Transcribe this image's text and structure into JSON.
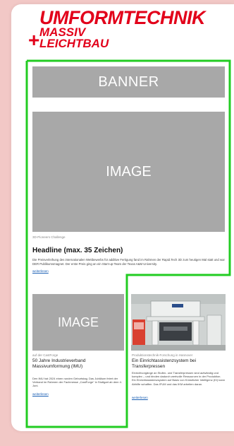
{
  "logo": {
    "line1": "UMFORMTECHNIK",
    "plus": "+",
    "line2a": "MASSIV",
    "line2b": "LEICHTBAU"
  },
  "banner": {
    "label": "BANNER"
  },
  "main_article": {
    "image_label": "IMAGE",
    "kicker": "3D-Pioneers Challenge",
    "headline": "Headline (max. 35 Zeichen)",
    "teaser": "Die Preisverleihung des internationalen Wettbewerbs für additive Fertigung fand im Rahmen der Rapid.Tech 3D zum heutigen Mal statt und war DER Publikumsmagnet. Der erste Preis ging an ein Start-up-Team der Texas A&M University.",
    "more": "weiterlesen"
  },
  "left_article": {
    "image_label": "IMAGE",
    "kicker": "auf der CastForge",
    "title": "50 Jahre Industrieverband Massivumformung (IMU)",
    "text": "Den IMU hat 2024 einen runden Geburtstag. Das Jubiläum feiert der Verband im Rahmen der Fachmesse „CastForge“ in Stuttgart ab dem 4. Juni.",
    "more": "weiterlesen"
  },
  "right_article": {
    "kicker": "Produktionstechnik-Forschung in Hannover",
    "title": "Ein Einrichtassistenzsystem bei Transferpressen",
    "text": "Einrichtvorgänge an Stufen- und Transferpressen sind aufwändig und komplex – und binden dadurch wertvolle Ressourcen in der Produktion. Ein Einrichtassistenzsystem auf Basis von Künstlicher Intelligenz (KI) kann Abhilfe schaffen. Das IFUM und das IKM arbeiten daran.",
    "more": "weiterlesen"
  },
  "colors": {
    "brand_red": "#e2001a",
    "highlight_green": "#22cc22",
    "placeholder_gray": "#a8a8a8",
    "background_pink": "#f2c8c6"
  }
}
